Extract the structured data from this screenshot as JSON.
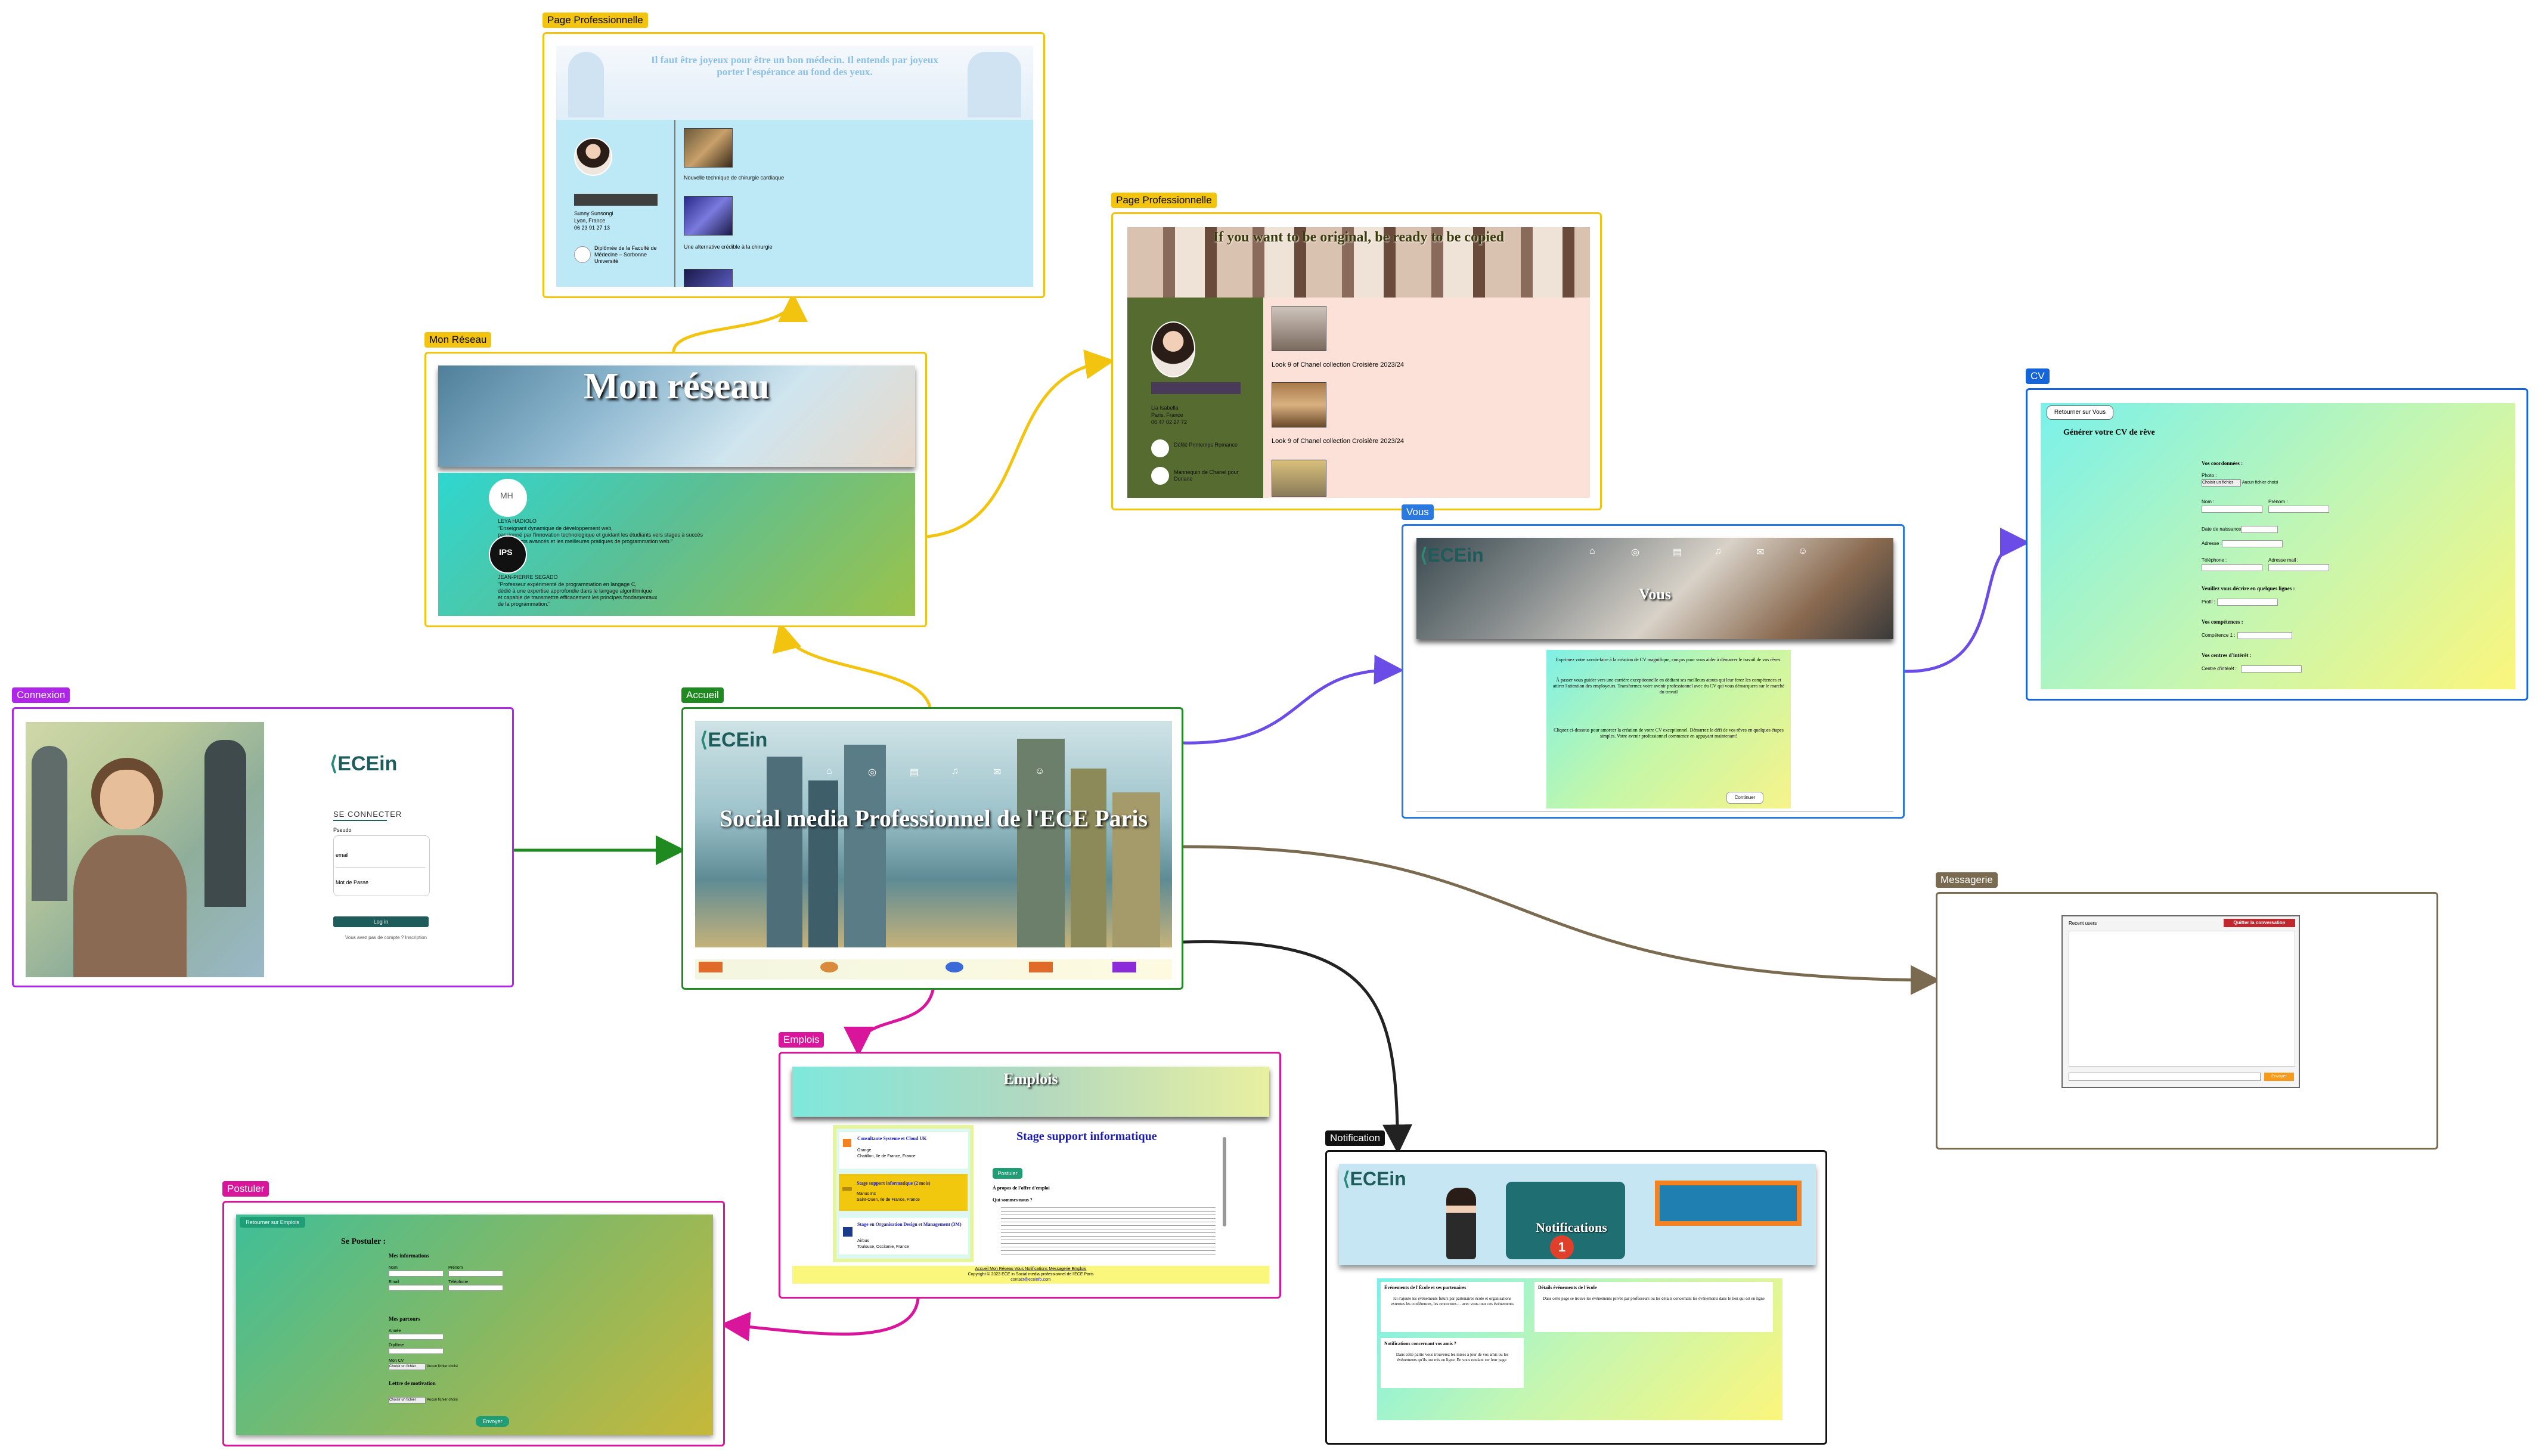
{
  "colors": {
    "connexion": "#b026e8",
    "accueil": "#1f8a1f",
    "mon_reseau": "#f2c40f",
    "page_pro": "#f2c40f",
    "vous": "#2979e0",
    "cv": "#1565d8",
    "messagerie": "#7a6a4f",
    "emplois": "#d9159b",
    "postuler": "#d9159b",
    "notification": "#111111",
    "edge_reseau": "#f2c40f",
    "edge_vous": "#6b4ce6",
    "edge_emplois": "#d9159b",
    "edge_connexion": "#1f8a1f",
    "edge_messagerie": "#7a6a4f",
    "edge_notification": "#222222"
  },
  "labels": {
    "connexion": "Connexion",
    "accueil": "Accueil",
    "mon_reseau": "Mon Réseau",
    "page_pro_1": "Page Professionnelle",
    "page_pro_2": "Page Professionnelle",
    "vous": "Vous",
    "cv": "CV",
    "messagerie": "Messagerie",
    "emplois": "Emplois",
    "postuler": "Postuler",
    "notification": "Notification"
  },
  "connexion": {
    "logo": "ECEin",
    "heading": "SE CONNECTER",
    "pseudo_label": "Pseudo",
    "email_label": "email",
    "password_label": "Mot de Passe",
    "button": "Log in",
    "footer": "Vous avez pas de compte ? Inscription"
  },
  "accueil": {
    "logo": "ECEin",
    "title": "Social media Professionnel de l'ECE Paris",
    "nav_icons": [
      "home-icon",
      "network-icon",
      "jobs-icon",
      "notification-icon",
      "message-icon",
      "profile-icon"
    ]
  },
  "mon_reseau": {
    "title": "Mon réseau",
    "contacts": [
      {
        "initials": "MH",
        "name": "LEYA HADIOLO",
        "text": "\"Enseignant dynamique de développement web,\npassionné par l'innovation technologique et guidant les étudiants vers stages à succès\nles concepts avancés et les meilleures pratiques de programmation web.\""
      },
      {
        "initials": "IPS",
        "name": "JEAN-PIERRE SEGADO",
        "text": "\"Professeur expérimenté de programmation en langage C,\ndédié à une expertise approfondie dans le langage algorithmique\net capable de transmettre efficacement les principes fondamentaux\nde la programmation.\""
      }
    ]
  },
  "page_pro_1": {
    "banner": "Il faut être joyeux pour être un bon médecin. Il entends par joyeux porter l'espérance au fond des yeux.",
    "name": "Sunny Sunsongi",
    "city": "Lyon, France",
    "phone": "06 23 91 27 13",
    "school": "Diplômée de la Faculté de Médecine – Sorbonne Université",
    "posts": [
      "Nouvelle technique de chirurgie cardiaque",
      "Une alternative crédible à la chirurgie"
    ]
  },
  "page_pro_2": {
    "banner": "If you want to be original, be ready to be copied",
    "name": "Lia Isabella",
    "city": "Paris, France",
    "phone": "06 47 02 27 72",
    "experience": [
      "Défilé Printemps Romance",
      "Mannequin de Chanel pour Doriane"
    ],
    "posts": [
      "Look 9 of Chanel collection Croisière 2023/24",
      "Look 9 of Chanel collection Croisière 2023/24"
    ]
  },
  "vous": {
    "logo": "ECEin",
    "title": "Vous",
    "text1": "Exprimez votre savoir-faire à la création de CV magnifique, conçus pour vous aider à démarrer le travail de vos rêves.",
    "text2": "À passer vous guider vers une carrière exceptionnelle en dédiant ses meilleurs atouts qui leur ferez les compétences et attirer l'attention des employeurs. Transformez votre avenir professionnel avec du CV qui vous démarquera sur le marché du travail",
    "text3": "Cliquez ci-dessous pour amorcer la création de votre CV exceptionnel. Démarrez le défi de vos rêves en quelques étapes simples. Votre avenir professionnel commence en appuyant maintenant!",
    "button": "Continuer"
  },
  "cv": {
    "back_button": "Retourner sur Vous",
    "title": "Générer votre CV de rêve",
    "section_coords": "Vos coordonnées :",
    "photo_label": "Photo :",
    "photo_btn": "Choisir un fichier",
    "photo_none": "Aucun fichier choisi",
    "nom": "Nom :",
    "prenom": "Prénom :",
    "naissance": "Date de naissance :",
    "adresse": "Adresse :",
    "telephone": "Téléphone :",
    "email": "Adresse mail :",
    "section_desc": "Veuillez vous décrire en quelques lignes :",
    "profil": "Profil :",
    "section_comp": "Vos compétences :",
    "competence": "Compétence 1 :",
    "section_interets": "Vos centres d'intérêt :",
    "interet": "Centre d'intérêt :"
  },
  "messagerie": {
    "header": "Recent users",
    "quit": "Quitter la conversation",
    "send": "Envoyer"
  },
  "emplois": {
    "title": "Emplois",
    "jobs": [
      {
        "title": "Consultante Systeme et Cloud UK",
        "company": "Orange",
        "place": "Chatillon, Ile de France, France"
      },
      {
        "title": "Stage support informatique (2 mois)",
        "company": "Manus Inc",
        "place": "Saint-Ouen, Ile de France, France"
      },
      {
        "title": "Stage en Organisation Design et Management (3M)",
        "company": "Airbus",
        "place": "Toulouse, Occitanie, France"
      }
    ],
    "detail_title": "Stage support informatique",
    "postuler": "Postuler",
    "about": "À propos de l'offre d'emploi",
    "who": "Qui sommes-nous ?",
    "footer_links": "Accueil  Mon Réseau  Vous  Notifications  Messagerie  Emplois",
    "copyright": "Copyright © 2023 ECE in Social media professionnel de l'ECE Paris",
    "contact": "contact@eceinfo.com"
  },
  "postuler": {
    "back": "Retourner sur Emplois",
    "title": "Se Postuler :",
    "infos": "Mes informations",
    "nom": "Nom",
    "prenom": "Prénom",
    "email": "Email",
    "telephone": "Téléphone",
    "parcours": "Mes parcours",
    "annee": "Année",
    "diplome": "Diplôme",
    "cv_label": "Mon CV",
    "motivation": "Lettre de motivation",
    "file_btn": "Choisir un fichier",
    "file_none": "Aucun fichier choisi",
    "button": "Envoyer"
  },
  "notification": {
    "logo": "ECEin",
    "title": "Notifications",
    "badge": "1",
    "cards": [
      {
        "title": "Événements de l'École et ses partenaires",
        "text": "Ici s'ajoute les événements futurs par partenaires école et organisations externes les conférences, les rencontres… avec vous tous ces événements"
      },
      {
        "title": "Détails événements de l'école",
        "text": "Dans cette page se trouve les événements privés par professeurs ou les détails concernant les événements dans le lien qui est en ligne"
      },
      {
        "title": "Notifications concernant vos amis ?",
        "text": "Dans cette partie vous trouverez les mises à jour de vos amis ou les événements qu'ils ont mis en ligne. En vous rendant sur leur page."
      }
    ]
  }
}
